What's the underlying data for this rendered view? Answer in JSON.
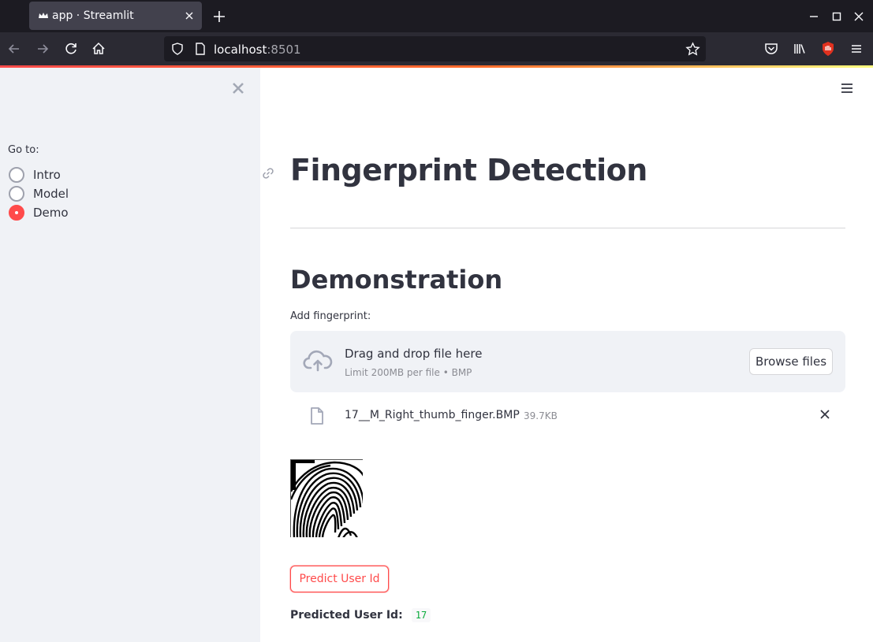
{
  "browser": {
    "tab_title": "app · Streamlit",
    "url_host": "localhost",
    "url_port": ":8501"
  },
  "sidebar": {
    "radio_label": "Go to:",
    "options": [
      {
        "label": "Intro",
        "selected": false
      },
      {
        "label": "Model",
        "selected": false
      },
      {
        "label": "Demo",
        "selected": true
      }
    ]
  },
  "main": {
    "title": "Fingerprint Detection",
    "subtitle": "Demonstration",
    "uploader": {
      "label": "Add fingerprint:",
      "drop_text": "Drag and drop file here",
      "limit_text": "Limit 200MB per file • BMP",
      "browse_label": "Browse files"
    },
    "uploaded_file": {
      "name": "17__M_Right_thumb_finger.BMP",
      "size": "39.7KB"
    },
    "predict_button": "Predict User Id",
    "result": {
      "label": "Predicted User Id:",
      "value": "17"
    }
  },
  "colors": {
    "primary": "#ff4b4b",
    "sidebar_bg": "#f0f2f6",
    "text": "#31333f",
    "result_green": "#09ab3b"
  }
}
